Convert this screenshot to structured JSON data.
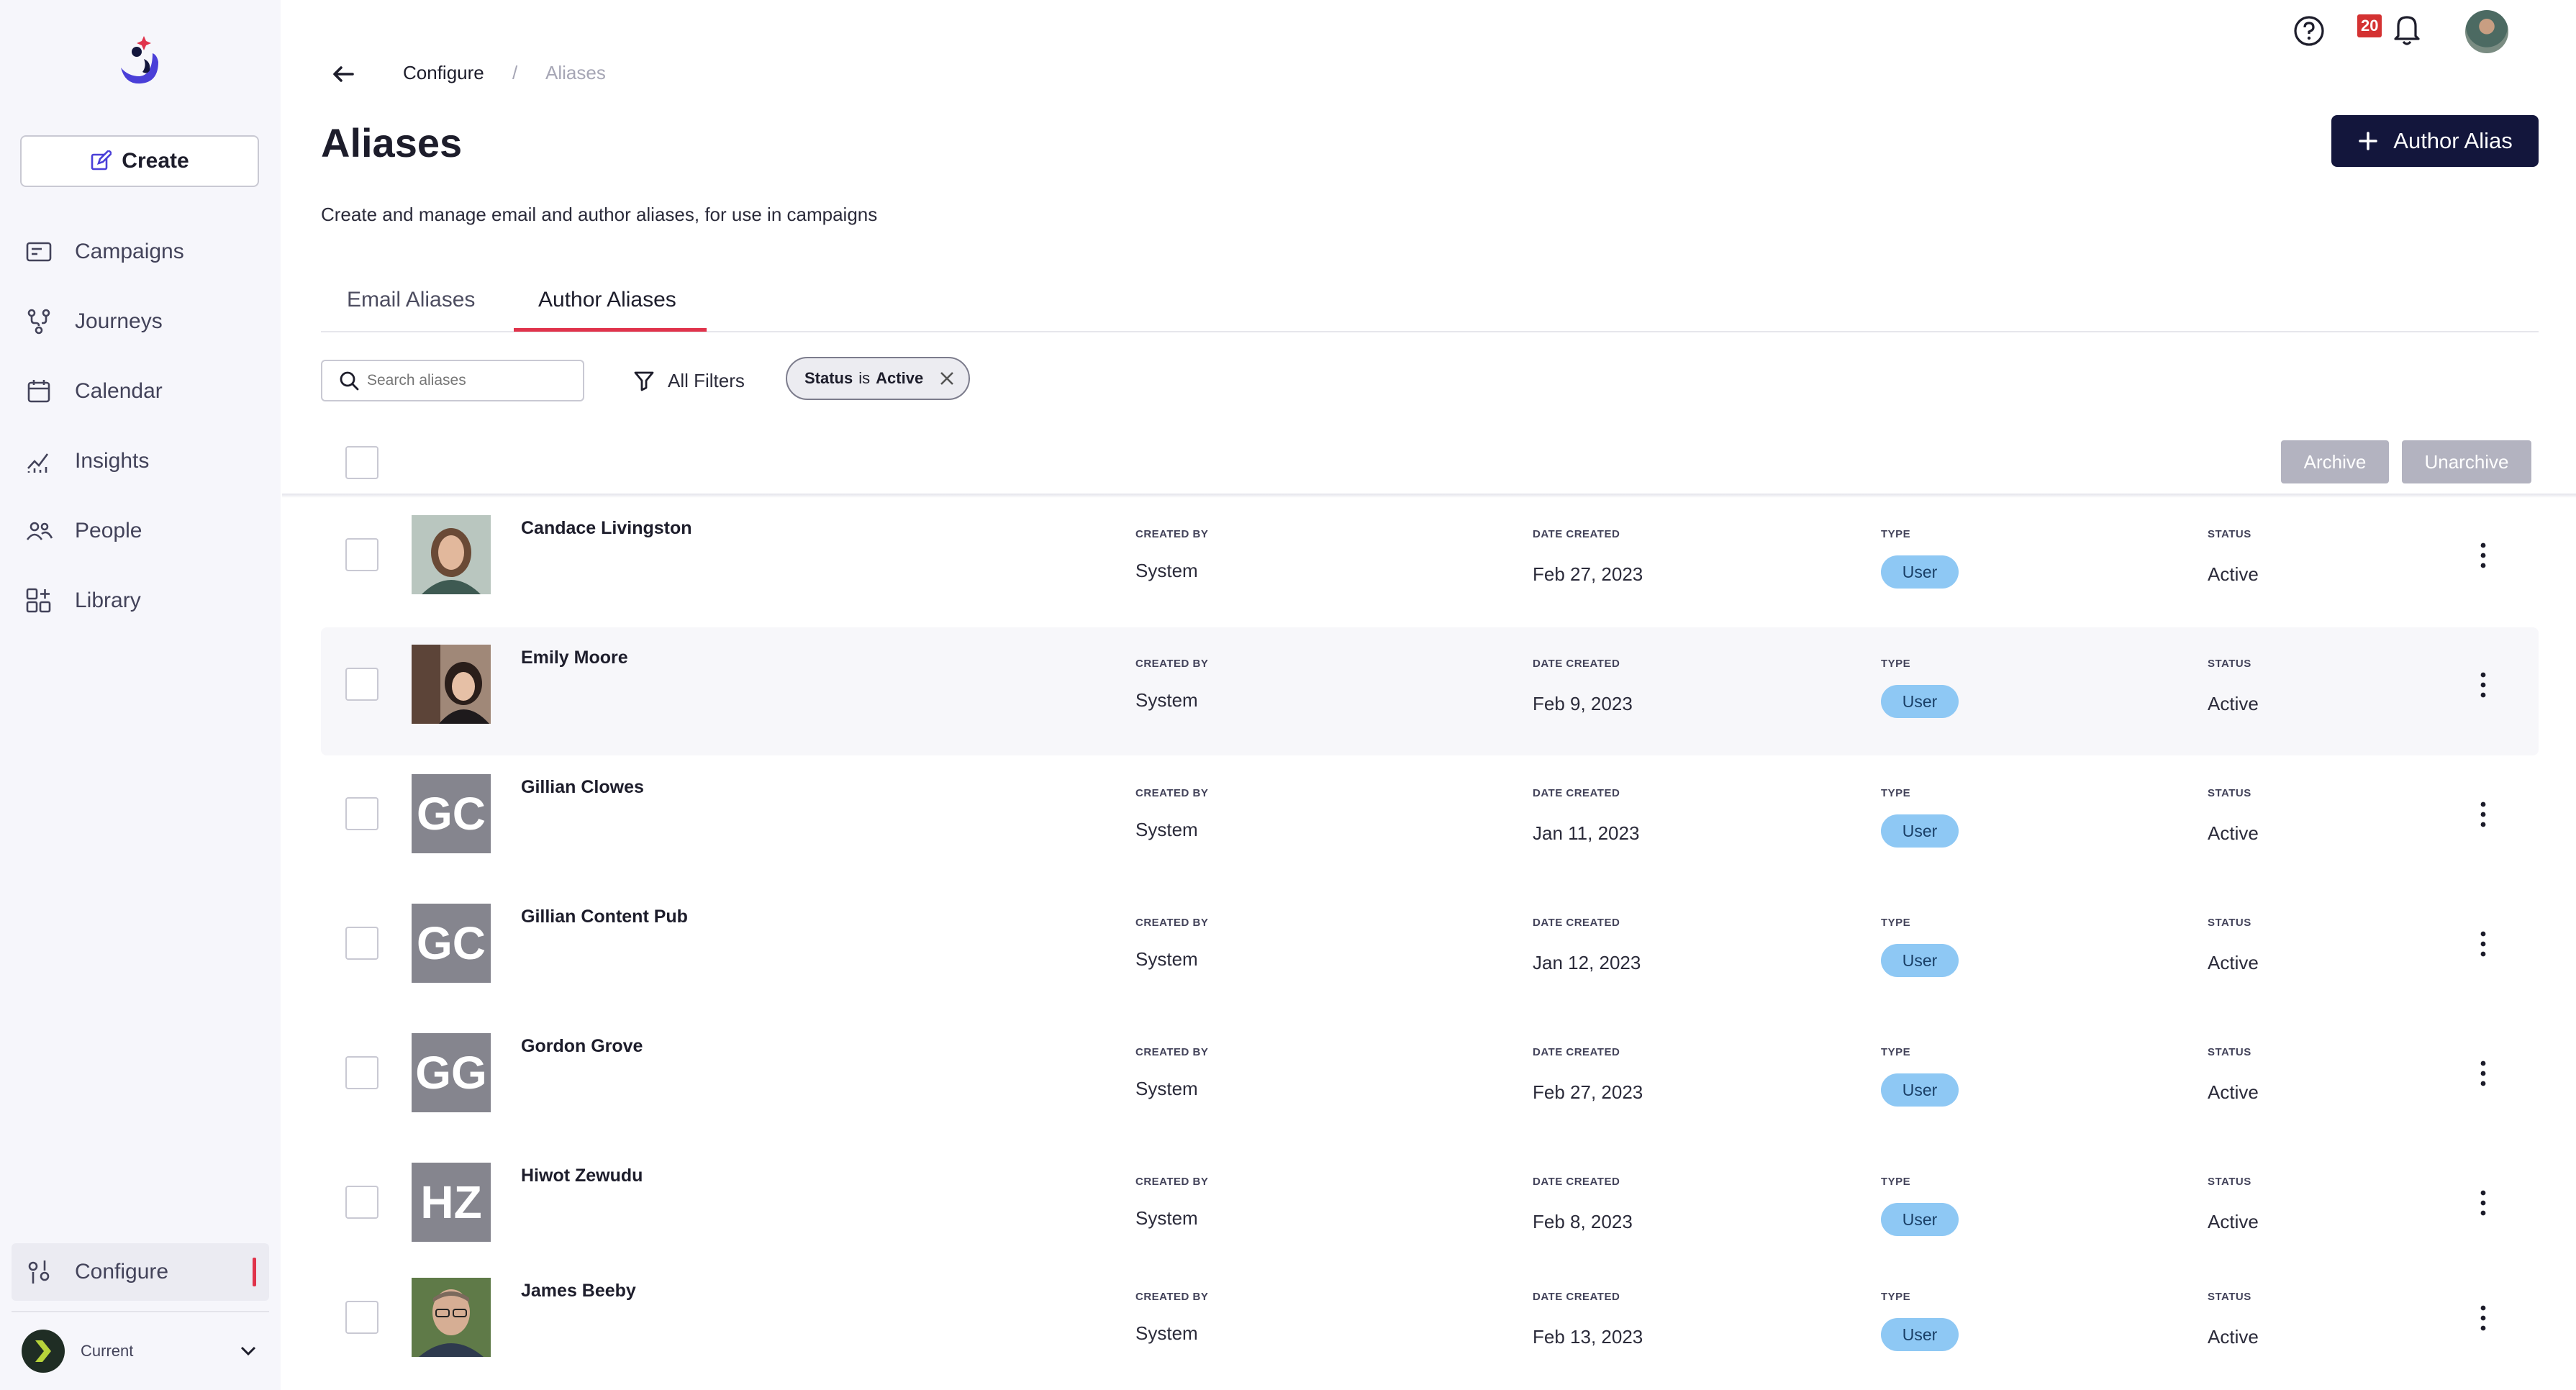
{
  "sidebar": {
    "create_label": "Create",
    "items": [
      {
        "label": "Campaigns",
        "icon": "campaigns-icon"
      },
      {
        "label": "Journeys",
        "icon": "journeys-icon"
      },
      {
        "label": "Calendar",
        "icon": "calendar-icon"
      },
      {
        "label": "Insights",
        "icon": "insights-icon"
      },
      {
        "label": "People",
        "icon": "people-icon"
      },
      {
        "label": "Library",
        "icon": "library-icon"
      }
    ],
    "configure_label": "Configure",
    "workspace_label": "Current"
  },
  "topbar": {
    "notification_count": "20"
  },
  "breadcrumb": {
    "parent": "Configure",
    "separator": "/",
    "current": "Aliases"
  },
  "page": {
    "title": "Aliases",
    "subtitle": "Create and manage email and author aliases, for use in campaigns",
    "primary_button": "Author Alias"
  },
  "tabs": [
    {
      "label": "Email Aliases",
      "active": false
    },
    {
      "label": "Author Aliases",
      "active": true
    }
  ],
  "toolbar": {
    "search_placeholder": "Search aliases",
    "filters_label": "All Filters",
    "chip_prefix": "Status",
    "chip_is": "is",
    "chip_value": "Active",
    "archive_label": "Archive",
    "unarchive_label": "Unarchive"
  },
  "columns": {
    "created_by": "CREATED BY",
    "date_created": "DATE CREATED",
    "type": "TYPE",
    "status": "STATUS"
  },
  "rows": [
    {
      "name": "Candace Livingston",
      "avatar": "photo",
      "created_by": "System",
      "date": "Feb 27, 2023",
      "type": "User",
      "status": "Active"
    },
    {
      "name": "Emily Moore",
      "avatar": "photo",
      "created_by": "System",
      "date": "Feb 9, 2023",
      "type": "User",
      "status": "Active"
    },
    {
      "name": "Gillian Clowes",
      "avatar": "initials",
      "initials": "GC",
      "created_by": "System",
      "date": "Jan 11, 2023",
      "type": "User",
      "status": "Active"
    },
    {
      "name": "Gillian Content Pub",
      "avatar": "initials",
      "initials": "GC",
      "created_by": "System",
      "date": "Jan 12, 2023",
      "type": "User",
      "status": "Active"
    },
    {
      "name": "Gordon Grove",
      "avatar": "initials",
      "initials": "GG",
      "created_by": "System",
      "date": "Feb 27, 2023",
      "type": "User",
      "status": "Active"
    },
    {
      "name": "Hiwot Zewudu",
      "avatar": "initials",
      "initials": "HZ",
      "created_by": "System",
      "date": "Feb 8, 2023",
      "type": "User",
      "status": "Active"
    },
    {
      "name": "James Beeby",
      "avatar": "photo",
      "created_by": "System",
      "date": "Feb 13, 2023",
      "type": "User",
      "status": "Active"
    }
  ],
  "colors": {
    "accent": "#e0334b",
    "primary_button": "#13163c",
    "type_pill": "#8ec8f4",
    "sidebar_bg": "#f6f6fb"
  }
}
